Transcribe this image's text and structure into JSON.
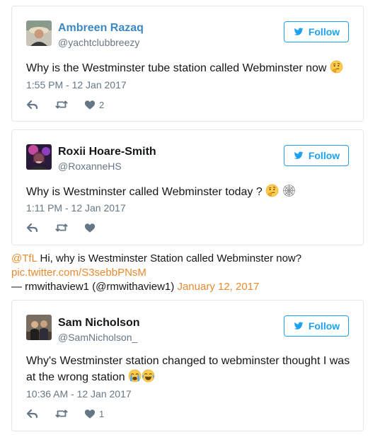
{
  "colors": {
    "accent": "#1da1f2",
    "link": "#e88a2f",
    "muted": "#657786",
    "border": "#e1e8ed"
  },
  "tweets": [
    {
      "name": "Ambreen Razaq",
      "handle": "@yachtclubbreezy",
      "follow_label": "Follow",
      "text": "Why is the Westminster tube station called Webminster now",
      "emojis": [
        "thinking-face"
      ],
      "timestamp": "1:55 PM - 12 Jan 2017",
      "like_count": "2"
    },
    {
      "name": "Roxii Hoare-Smith",
      "handle": "@RoxanneHS",
      "follow_label": "Follow",
      "text": "Why is Westminster called Webminster today ?",
      "emojis": [
        "thinking-face",
        "spider-web"
      ],
      "timestamp": "1:11 PM - 12 Jan 2017",
      "like_count": ""
    },
    {
      "name": "Sam Nicholson",
      "handle": "@SamNicholson_",
      "follow_label": "Follow",
      "text_line1": "Why's Westminster station changed to webminster thought I was",
      "text_line2": "at the wrong station",
      "emojis": [
        "crying-face",
        "tears-of-joy-face"
      ],
      "timestamp": "10:36 AM - 12 Jan 2017",
      "like_count": "1"
    }
  ],
  "embed": {
    "mention": "@TfL",
    "text": " Hi, why is Westminster Station called Webminster now?",
    "link": "pic.twitter.com/S3sebbPNsM",
    "attribution": "— rmwithaview1 (@rmwithaview1)",
    "date": "January 12, 2017"
  }
}
